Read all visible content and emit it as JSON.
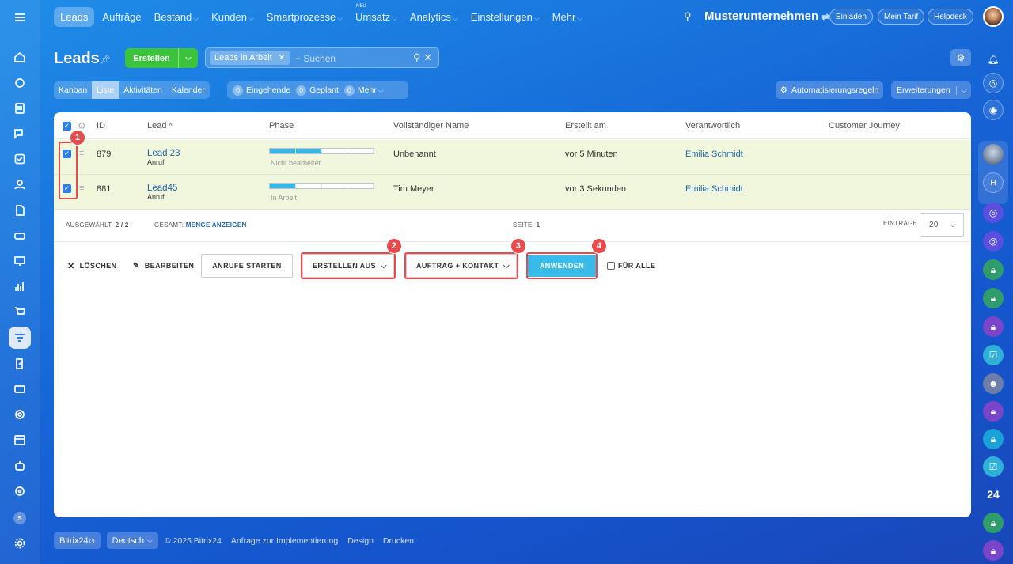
{
  "topnav": {
    "items": [
      "Leads",
      "Aufträge",
      "Bestand",
      "Kunden",
      "Smartprozesse",
      "Umsatz",
      "Analytics",
      "Einstellungen",
      "Mehr"
    ],
    "new_badge": "NEU",
    "company": "Musterunternehmen",
    "invite": "Einladen",
    "tariff": "Mein Tarif",
    "helpdesk": "Helpdesk"
  },
  "header": {
    "title": "Leads",
    "create_label": "Erstellen",
    "filter_chip": "Leads in Arbeit",
    "search_placeholder": "+ Suchen"
  },
  "views": {
    "tabs": [
      "Kanban",
      "Liste",
      "Aktivitäten",
      "Kalender"
    ],
    "selected": "Liste",
    "counters": [
      {
        "count": "0",
        "label": "Eingehende"
      },
      {
        "count": "0",
        "label": "Geplant"
      },
      {
        "count": "0",
        "label": "Mehr"
      }
    ],
    "automation": "Automatisierungsregeln",
    "extensions": "Erweiterungen"
  },
  "table": {
    "columns": [
      "ID",
      "Lead",
      "Phase",
      "Vollständiger Name",
      "Erstellt am",
      "Verantwortlich",
      "Customer Journey"
    ],
    "rows": [
      {
        "id": "879",
        "lead": "Lead 23",
        "source": "Anruf",
        "phase_label": "Nicht bearbeitet",
        "phase_filled": 0.5,
        "name": "Unbenannt",
        "created": "vor 5 Minuten",
        "owner": "Emilia Schmidt"
      },
      {
        "id": "881",
        "lead": "Lead45",
        "source": "Anruf",
        "phase_label": "In Arbeit",
        "phase_filled": 0.25,
        "name": "Tim Meyer",
        "created": "vor 3 Sekunden",
        "owner": "Emilia Schmidt"
      }
    ]
  },
  "summary": {
    "selected_label": "AUSGEWÄHLT:",
    "selected_value": "2 / 2",
    "total_label": "GESAMT:",
    "total_link": "MENGE ANZEIGEN",
    "page_label": "SEITE:",
    "page_value": "1",
    "entries_label": "EINTRÄGE",
    "entries_value": "20"
  },
  "actions": {
    "delete": "LÖSCHEN",
    "edit": "BEARBEITEN",
    "calls": "ANRUFE STARTEN",
    "create_from": "ERSTELLEN AUS",
    "target": "AUFTRAG + KONTAKT",
    "apply": "ANWENDEN",
    "for_all": "FÜR ALLE"
  },
  "badges": [
    "1",
    "2",
    "3",
    "4"
  ],
  "footer": {
    "brand": "Bitrix24",
    "language": "Deutsch",
    "copyright": "© 2025 Bitrix24",
    "links": [
      "Anfrage zur Implementierung",
      "Design",
      "Drucken"
    ]
  },
  "rightbar": {
    "number_label": "24",
    "initial": "H"
  },
  "leftbar": {
    "small_badge": "S"
  }
}
